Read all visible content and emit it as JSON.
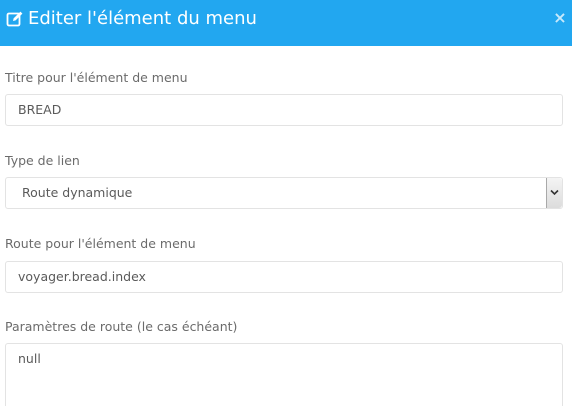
{
  "modal": {
    "title": "Editer l'élément du menu",
    "close_label": "×",
    "header_color": "#22a7f0"
  },
  "icons": {
    "header": "edit-icon",
    "close": "close-icon",
    "select_arrow": "chevron-down-icon"
  },
  "form": {
    "title_label": "Titre pour l'élément de menu",
    "title_value": "BREAD",
    "link_type_label": "Type de lien",
    "link_type_value": "Route dynamique",
    "route_label": "Route pour l'élément de menu",
    "route_value": "voyager.bread.index",
    "params_label": "Paramètres de route (le cas échéant)",
    "params_value": "null"
  }
}
